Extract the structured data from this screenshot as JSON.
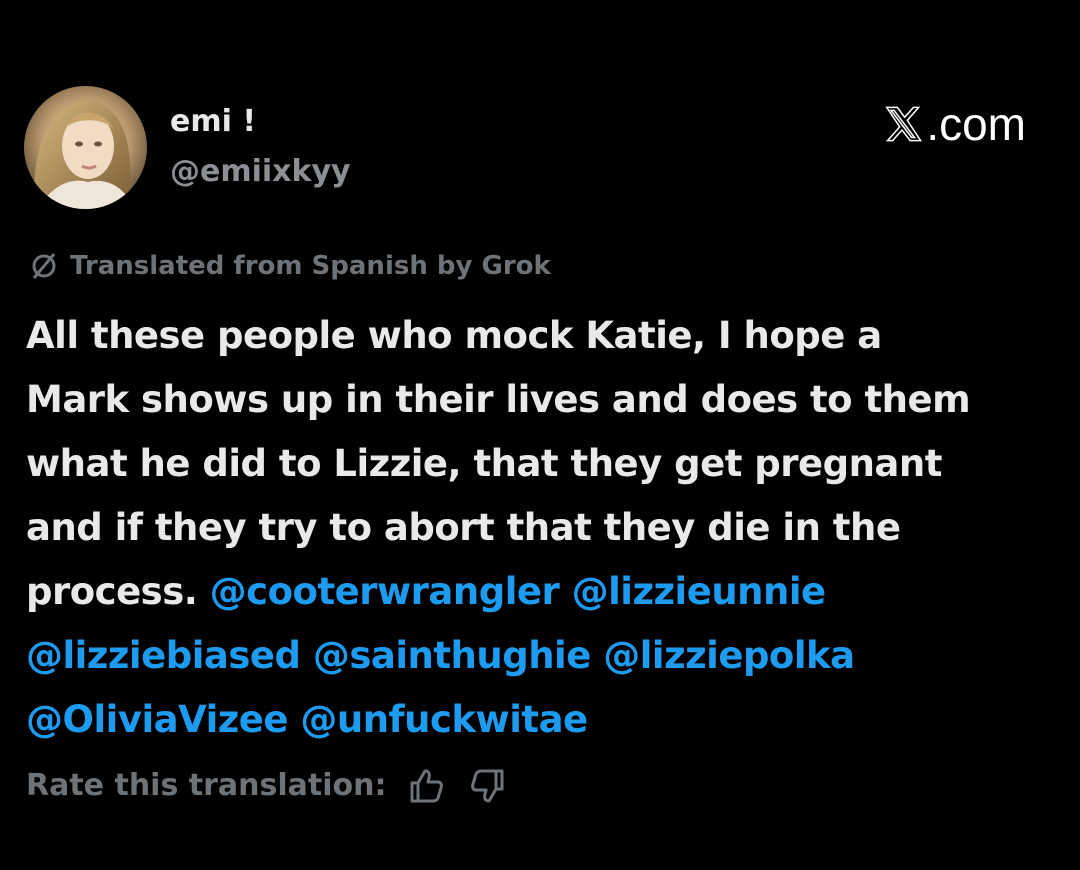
{
  "author": {
    "display_name": "emi !",
    "handle": "@emiixkyy"
  },
  "brand": {
    "logo_icon": "x-logo-icon",
    "text": ".com"
  },
  "translation": {
    "notice": "Translated from Spanish by Grok",
    "icon": "empty-set-icon"
  },
  "tweet": {
    "text_line_1": "All these people who mock Katie, I hope a",
    "text_line_2": "Mark shows up in their lives and does to them",
    "text_line_3": "what he did to Lizzie, that they get pregnant",
    "text_line_4": "and if they try to abort that they die in the",
    "text_line_5_prefix": "process.",
    "mentions": [
      "@cooterwrangler",
      "@lizzieunnie",
      "@lizziebiased",
      "@sainthughie",
      "@lizziepolka",
      "@OliviaVizee",
      "@unfuckwitae"
    ]
  },
  "rating": {
    "label": "Rate this translation:",
    "thumbs_up_icon": "thumbs-up-icon",
    "thumbs_down_icon": "thumbs-down-icon"
  },
  "colors": {
    "background": "#000000",
    "text": "#e7e9ea",
    "secondary": "#6e7378",
    "mention": "#1d9bf0"
  }
}
